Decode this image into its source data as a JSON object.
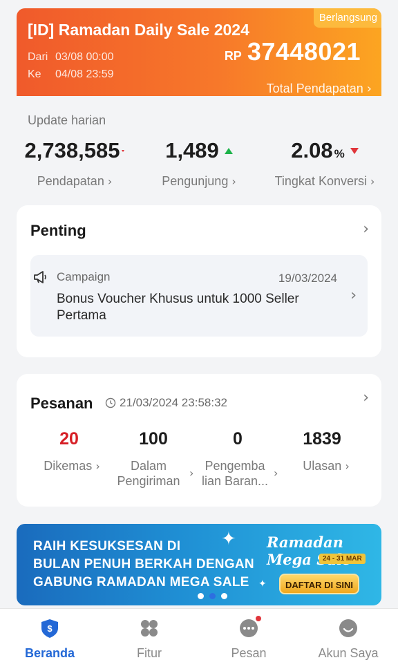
{
  "campaign": {
    "title": "[ID] Ramadan Daily Sale 2024",
    "status": "Berlangsung",
    "from_label": "Dari",
    "from_value": "03/08 00:00",
    "to_label": "Ke",
    "to_value": "04/08 23:59",
    "currency": "RP",
    "amount": "37448021",
    "total_label": "Total Pendapatan"
  },
  "daily": {
    "label": "Update harian",
    "metrics": [
      {
        "value": "2,738,585",
        "label": "Pendapatan"
      },
      {
        "value": "1,489",
        "label": "Pengunjung"
      },
      {
        "value": "2.08",
        "unit": "%",
        "label": "Tingkat Konversi"
      }
    ]
  },
  "important": {
    "title": "Penting",
    "notice": {
      "category": "Campaign",
      "date": "19/03/2024",
      "message": "Bonus Voucher Khusus untuk 1000 Seller Pertama"
    }
  },
  "orders": {
    "title": "Pesanan",
    "timestamp": "21/03/2024 23:58:32",
    "items": [
      {
        "value": "20",
        "label": "Dikemas"
      },
      {
        "value": "100",
        "label": "Dalam Pengiriman"
      },
      {
        "value": "0",
        "label": "Pengemba lian Baran..."
      },
      {
        "value": "1839",
        "label": "Ulasan"
      }
    ]
  },
  "promo": {
    "line1": "RAIH KESUKSESAN DI",
    "line2": "BULAN PENUH BERKAH DENGAN",
    "line3": "GABUNG RAMADAN MEGA SALE",
    "event_name": "Ramadan Mega Sale",
    "event_dates": "24 - 31 MAR",
    "cta": "DAFTAR DI SINI"
  },
  "nav": {
    "items": [
      {
        "label": "Beranda",
        "icon": "home-shield-icon",
        "active": true
      },
      {
        "label": "Fitur",
        "icon": "grid-icon",
        "active": false
      },
      {
        "label": "Pesan",
        "icon": "chat-icon",
        "active": false
      },
      {
        "label": "Akun Saya",
        "icon": "profile-icon",
        "active": false
      }
    ]
  },
  "colors": {
    "campaign_start": "#f05a2b",
    "campaign_end": "#fca521",
    "up": "#1db34a",
    "down": "#e0353b",
    "accent": "#2368d6",
    "order_highlight": "#d61f26"
  }
}
